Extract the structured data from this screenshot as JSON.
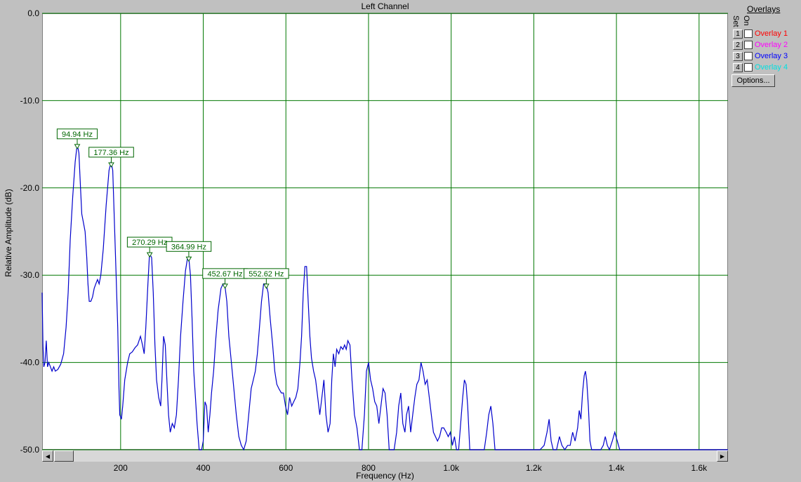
{
  "chart_data": {
    "type": "line",
    "title": "Left Channel",
    "xlabel": "Frequency (Hz)",
    "ylabel": "Relative Amplitude (dB)",
    "xlim": [
      10,
      1670
    ],
    "ylim": [
      -50,
      0
    ],
    "grid": true,
    "x_ticks": [
      200,
      400,
      600,
      800,
      1000,
      1200,
      1400,
      1600
    ],
    "x_tick_labels": [
      "200",
      "400",
      "600",
      "800",
      "1.0k",
      "1.2k",
      "1.4k",
      "1.6k"
    ],
    "y_ticks": [
      0,
      -10,
      -20,
      -30,
      -40,
      -50
    ],
    "y_tick_labels": [
      "0.0",
      "-10.0",
      "-20.0",
      "-30.0",
      "-40.0",
      "-50.0"
    ],
    "series": [
      {
        "color": "#0000cc",
        "points": [
          [
            10,
            -32
          ],
          [
            12,
            -38
          ],
          [
            14,
            -40.5
          ],
          [
            17,
            -40
          ],
          [
            20,
            -37.5
          ],
          [
            23,
            -40.5
          ],
          [
            26,
            -40
          ],
          [
            30,
            -40.5
          ],
          [
            34,
            -41
          ],
          [
            38,
            -40.5
          ],
          [
            42,
            -41
          ],
          [
            48,
            -40.8
          ],
          [
            55,
            -40.2
          ],
          [
            62,
            -39
          ],
          [
            68,
            -36
          ],
          [
            73,
            -32
          ],
          [
            78,
            -26
          ],
          [
            84,
            -21
          ],
          [
            90,
            -17
          ],
          [
            95,
            -15
          ],
          [
            99,
            -16
          ],
          [
            103,
            -20
          ],
          [
            106,
            -23
          ],
          [
            110,
            -24
          ],
          [
            114,
            -25
          ],
          [
            118,
            -28
          ],
          [
            121,
            -31
          ],
          [
            124,
            -33
          ],
          [
            128,
            -33
          ],
          [
            132,
            -32.5
          ],
          [
            136,
            -31.5
          ],
          [
            140,
            -31
          ],
          [
            144,
            -30.5
          ],
          [
            148,
            -31
          ],
          [
            152,
            -30
          ],
          [
            158,
            -27
          ],
          [
            165,
            -22
          ],
          [
            172,
            -18
          ],
          [
            177,
            -17
          ],
          [
            181,
            -18
          ],
          [
            185,
            -24
          ],
          [
            189,
            -30
          ],
          [
            193,
            -36
          ],
          [
            196,
            -43
          ],
          [
            198,
            -46
          ],
          [
            202,
            -46.5
          ],
          [
            205,
            -45
          ],
          [
            210,
            -42
          ],
          [
            217,
            -40
          ],
          [
            222,
            -39
          ],
          [
            228,
            -38.8
          ],
          [
            235,
            -38.3
          ],
          [
            241,
            -38
          ],
          [
            248,
            -37
          ],
          [
            253,
            -38
          ],
          [
            257,
            -39
          ],
          [
            261,
            -36
          ],
          [
            266,
            -31
          ],
          [
            270,
            -27.5
          ],
          [
            275,
            -28
          ],
          [
            279,
            -32
          ],
          [
            283,
            -38
          ],
          [
            287,
            -42
          ],
          [
            292,
            -44
          ],
          [
            297,
            -45
          ],
          [
            300,
            -42
          ],
          [
            304,
            -37
          ],
          [
            308,
            -38
          ],
          [
            312,
            -42
          ],
          [
            316,
            -46
          ],
          [
            320,
            -48
          ],
          [
            325,
            -47
          ],
          [
            330,
            -47.5
          ],
          [
            335,
            -46
          ],
          [
            340,
            -42
          ],
          [
            345,
            -37
          ],
          [
            351,
            -33
          ],
          [
            357,
            -29.5
          ],
          [
            362,
            -28
          ],
          [
            365,
            -28
          ],
          [
            369,
            -30
          ],
          [
            373,
            -35
          ],
          [
            377,
            -41
          ],
          [
            381,
            -44
          ],
          [
            385,
            -47
          ],
          [
            390,
            -50
          ],
          [
            396,
            -50
          ],
          [
            400,
            -49
          ],
          [
            404,
            -44.5
          ],
          [
            408,
            -45
          ],
          [
            412,
            -48
          ],
          [
            416,
            -46
          ],
          [
            420,
            -43.5
          ],
          [
            425,
            -41
          ],
          [
            430,
            -37.5
          ],
          [
            436,
            -34
          ],
          [
            443,
            -31.5
          ],
          [
            448,
            -31
          ],
          [
            452,
            -31
          ],
          [
            457,
            -33
          ],
          [
            462,
            -37
          ],
          [
            468,
            -40
          ],
          [
            474,
            -43
          ],
          [
            480,
            -46
          ],
          [
            486,
            -48.5
          ],
          [
            492,
            -49.5
          ],
          [
            498,
            -50
          ],
          [
            504,
            -49
          ],
          [
            510,
            -46
          ],
          [
            516,
            -43
          ],
          [
            521,
            -42
          ],
          [
            526,
            -41
          ],
          [
            531,
            -39
          ],
          [
            536,
            -36
          ],
          [
            541,
            -33
          ],
          [
            546,
            -31
          ],
          [
            552,
            -31
          ],
          [
            557,
            -32
          ],
          [
            562,
            -35
          ],
          [
            568,
            -38
          ],
          [
            573,
            -41
          ],
          [
            578,
            -42.5
          ],
          [
            583,
            -43
          ],
          [
            589,
            -43.5
          ],
          [
            594,
            -43.5
          ],
          [
            599,
            -45
          ],
          [
            604,
            -46
          ],
          [
            609,
            -44
          ],
          [
            614,
            -45
          ],
          [
            619,
            -44.5
          ],
          [
            624,
            -44
          ],
          [
            629,
            -43
          ],
          [
            634,
            -40
          ],
          [
            638,
            -37
          ],
          [
            642,
            -32
          ],
          [
            646,
            -29
          ],
          [
            650,
            -29
          ],
          [
            654,
            -33
          ],
          [
            658,
            -37
          ],
          [
            662,
            -39.5
          ],
          [
            667,
            -41
          ],
          [
            672,
            -42
          ],
          [
            677,
            -44
          ],
          [
            682,
            -46
          ],
          [
            687,
            -44
          ],
          [
            692,
            -42
          ],
          [
            697,
            -46
          ],
          [
            702,
            -48
          ],
          [
            707,
            -47
          ],
          [
            711,
            -42
          ],
          [
            715,
            -39
          ],
          [
            719,
            -40.5
          ],
          [
            723,
            -38.5
          ],
          [
            728,
            -39
          ],
          [
            733,
            -38.2
          ],
          [
            738,
            -38.5
          ],
          [
            742,
            -38
          ],
          [
            746,
            -38.5
          ],
          [
            750,
            -37.5
          ],
          [
            755,
            -38
          ],
          [
            760,
            -42
          ],
          [
            766,
            -46
          ],
          [
            772,
            -47.5
          ],
          [
            778,
            -50
          ],
          [
            784,
            -50
          ],
          [
            790,
            -46
          ],
          [
            795,
            -41
          ],
          [
            800,
            -40
          ],
          [
            805,
            -42
          ],
          [
            810,
            -43
          ],
          [
            815,
            -44.5
          ],
          [
            820,
            -45
          ],
          [
            825,
            -47
          ],
          [
            830,
            -45
          ],
          [
            835,
            -43
          ],
          [
            840,
            -43.5
          ],
          [
            845,
            -46
          ],
          [
            850,
            -50
          ],
          [
            856,
            -50
          ],
          [
            862,
            -50
          ],
          [
            868,
            -48
          ],
          [
            873,
            -45
          ],
          [
            878,
            -43.5
          ],
          [
            883,
            -47
          ],
          [
            888,
            -48
          ],
          [
            892,
            -46
          ],
          [
            897,
            -45
          ],
          [
            902,
            -48
          ],
          [
            907,
            -46
          ],
          [
            912,
            -44
          ],
          [
            917,
            -42.5
          ],
          [
            922,
            -42
          ],
          [
            927,
            -40
          ],
          [
            932,
            -41
          ],
          [
            937,
            -42.5
          ],
          [
            942,
            -42
          ],
          [
            947,
            -44
          ],
          [
            952,
            -46
          ],
          [
            957,
            -48
          ],
          [
            962,
            -48.5
          ],
          [
            967,
            -49
          ],
          [
            972,
            -48.5
          ],
          [
            977,
            -47.5
          ],
          [
            982,
            -47.5
          ],
          [
            988,
            -48
          ],
          [
            993,
            -48.5
          ],
          [
            998,
            -48
          ],
          [
            1003,
            -49.5
          ],
          [
            1008,
            -48.5
          ],
          [
            1013,
            -50
          ],
          [
            1018,
            -50
          ],
          [
            1023,
            -47
          ],
          [
            1028,
            -44
          ],
          [
            1032,
            -42
          ],
          [
            1036,
            -42.5
          ],
          [
            1040,
            -45
          ],
          [
            1045,
            -50
          ],
          [
            1050,
            -50
          ],
          [
            1060,
            -50
          ],
          [
            1070,
            -50
          ],
          [
            1080,
            -50
          ],
          [
            1086,
            -48
          ],
          [
            1091,
            -46
          ],
          [
            1096,
            -45
          ],
          [
            1101,
            -47
          ],
          [
            1106,
            -50
          ],
          [
            1120,
            -50
          ],
          [
            1140,
            -50
          ],
          [
            1160,
            -50
          ],
          [
            1180,
            -50
          ],
          [
            1200,
            -50
          ],
          [
            1215,
            -50
          ],
          [
            1225,
            -49.5
          ],
          [
            1232,
            -48
          ],
          [
            1237,
            -46.5
          ],
          [
            1242,
            -49
          ],
          [
            1247,
            -50
          ],
          [
            1255,
            -50
          ],
          [
            1262,
            -48.5
          ],
          [
            1268,
            -49.5
          ],
          [
            1275,
            -50
          ],
          [
            1282,
            -49.5
          ],
          [
            1288,
            -49.5
          ],
          [
            1294,
            -48
          ],
          [
            1300,
            -49
          ],
          [
            1306,
            -47.5
          ],
          [
            1310,
            -45.5
          ],
          [
            1314,
            -46.5
          ],
          [
            1318,
            -43.5
          ],
          [
            1322,
            -41.5
          ],
          [
            1325,
            -41
          ],
          [
            1328,
            -42
          ],
          [
            1332,
            -45
          ],
          [
            1336,
            -49
          ],
          [
            1340,
            -50
          ],
          [
            1350,
            -50
          ],
          [
            1362,
            -50
          ],
          [
            1368,
            -49.5
          ],
          [
            1373,
            -48.5
          ],
          [
            1378,
            -49.5
          ],
          [
            1383,
            -50
          ],
          [
            1390,
            -49
          ],
          [
            1396,
            -48
          ],
          [
            1402,
            -49
          ],
          [
            1408,
            -50
          ],
          [
            1430,
            -50
          ],
          [
            1460,
            -50
          ],
          [
            1500,
            -50
          ],
          [
            1550,
            -50
          ],
          [
            1600,
            -50
          ],
          [
            1650,
            -50
          ],
          [
            1670,
            -50
          ]
        ]
      }
    ],
    "annotations": [
      {
        "text": "94.94 Hz",
        "x": 94.94,
        "y": -15.5
      },
      {
        "text": "177.36 Hz",
        "x": 177.36,
        "y": -17.6
      },
      {
        "text": "270.29 Hz",
        "x": 270.29,
        "y": -27.9
      },
      {
        "text": "364.99 Hz",
        "x": 364.99,
        "y": -28.4
      },
      {
        "text": "452.67 Hz",
        "x": 452.67,
        "y": -31.5
      },
      {
        "text": "552.62 Hz",
        "x": 552.62,
        "y": -31.5
      }
    ]
  },
  "overlays": {
    "title": "Overlays",
    "set_header": "Set",
    "on_header": "On",
    "items": [
      {
        "num": "1",
        "label": "Overlay 1",
        "color": "#ff0000",
        "checked": false
      },
      {
        "num": "2",
        "label": "Overlay 2",
        "color": "#ff00ff",
        "checked": false
      },
      {
        "num": "3",
        "label": "Overlay 3",
        "color": "#0000ff",
        "checked": false
      },
      {
        "num": "4",
        "label": "Overlay 4",
        "color": "#00ffff",
        "checked": false
      }
    ],
    "options_label": "Options..."
  },
  "colors": {
    "grid": "#007700",
    "annotation": "#006600",
    "plot_bg": "#ffffff",
    "window_bg": "#c0c0c0"
  }
}
